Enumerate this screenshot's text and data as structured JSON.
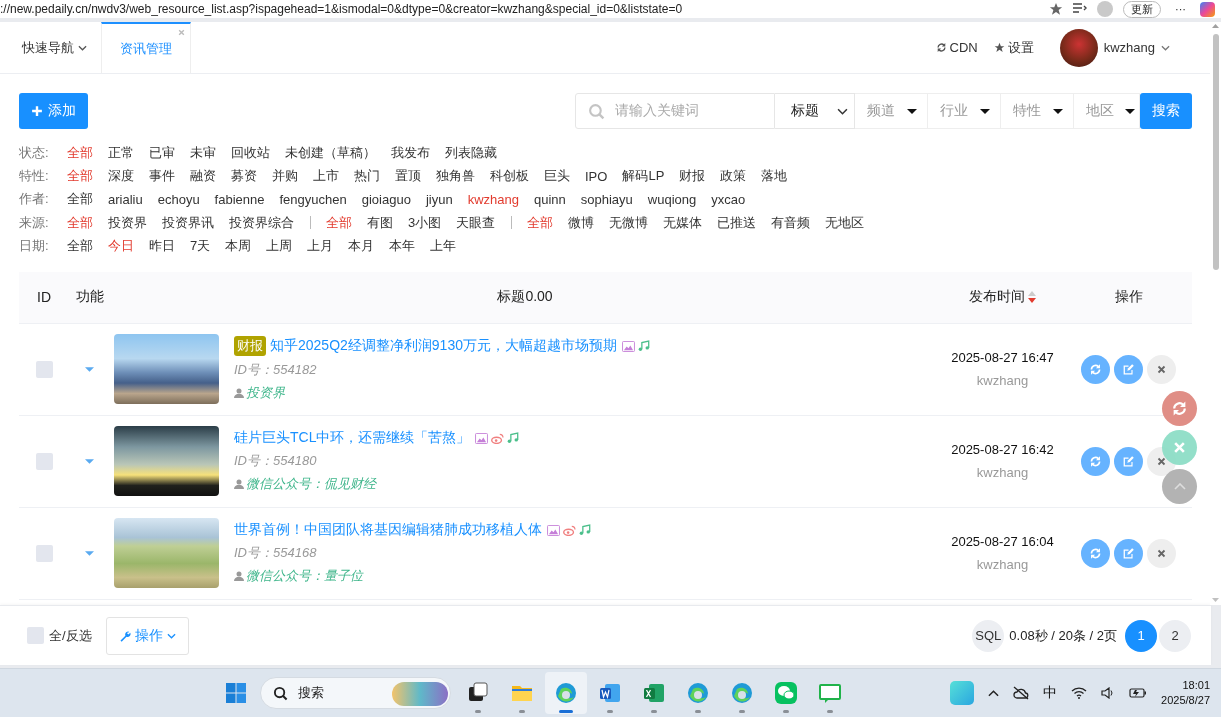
{
  "browser": {
    "url": "://new.pedaily.cn/nwdv3/web_resource_list.asp?ispagehead=1&ismodal=0&dtype=0&creator=kwzhang&special_id=0&liststate=0",
    "update_button": "更新",
    "more_button": "···"
  },
  "header": {
    "nav": "快速导航",
    "tabs": [
      {
        "label": "资讯管理",
        "selected": true
      }
    ],
    "links": [
      {
        "kind": "cdn",
        "label": "CDN"
      },
      {
        "kind": "settings",
        "label": "设置"
      }
    ],
    "user": "kwzhang"
  },
  "toolbar": {
    "add_button": "添加",
    "search": {
      "placeholder": "请输入关键词"
    },
    "field_select": "标题",
    "dropdowns": [
      "频道",
      "行业",
      "特性",
      "地区"
    ],
    "search_button": "搜索"
  },
  "filters": [
    {
      "label": "状态:",
      "groups": [
        [
          {
            "text": "全部",
            "selected": true
          },
          {
            "text": "正常",
            "selected": false
          },
          {
            "text": "已审",
            "selected": false
          },
          {
            "text": "未审",
            "selected": false
          },
          {
            "text": "回收站",
            "selected": false
          },
          {
            "text": "未创建（草稿）",
            "selected": false
          },
          {
            "text": "我发布",
            "selected": false
          },
          {
            "text": "列表隐藏",
            "selected": false
          }
        ]
      ]
    },
    {
      "label": "特性:",
      "groups": [
        [
          {
            "text": "全部",
            "selected": true
          },
          {
            "text": "深度",
            "selected": false
          },
          {
            "text": "事件",
            "selected": false
          },
          {
            "text": "融资",
            "selected": false
          },
          {
            "text": "募资",
            "selected": false
          },
          {
            "text": "并购",
            "selected": false
          },
          {
            "text": "上市",
            "selected": false
          },
          {
            "text": "热门",
            "selected": false
          },
          {
            "text": "置顶",
            "selected": false
          },
          {
            "text": "独角兽",
            "selected": false
          },
          {
            "text": "科创板",
            "selected": false
          },
          {
            "text": "巨头",
            "selected": false
          },
          {
            "text": "IPO",
            "selected": false
          },
          {
            "text": "解码LP",
            "selected": false
          },
          {
            "text": "财报",
            "selected": false
          },
          {
            "text": "政策",
            "selected": false
          },
          {
            "text": "落地",
            "selected": false
          }
        ]
      ]
    },
    {
      "label": "作者:",
      "groups": [
        [
          {
            "text": "全部",
            "selected": false
          },
          {
            "text": "arialiu",
            "selected": false
          },
          {
            "text": "echoyu",
            "selected": false
          },
          {
            "text": "fabienne",
            "selected": false
          },
          {
            "text": "fengyuchen",
            "selected": false
          },
          {
            "text": "gioiaguo",
            "selected": false
          },
          {
            "text": "jiyun",
            "selected": false
          },
          {
            "text": "kwzhang",
            "selected": true
          },
          {
            "text": "quinn",
            "selected": false
          },
          {
            "text": "sophiayu",
            "selected": false
          },
          {
            "text": "wuqiong",
            "selected": false
          },
          {
            "text": "yxcao",
            "selected": false
          }
        ]
      ]
    },
    {
      "label": "来源:",
      "groups": [
        [
          {
            "text": "全部",
            "selected": true
          },
          {
            "text": "投资界",
            "selected": false
          },
          {
            "text": "投资界讯",
            "selected": false
          },
          {
            "text": "投资界综合",
            "selected": false
          }
        ],
        [
          {
            "text": "全部",
            "selected": true
          },
          {
            "text": "有图",
            "selected": false
          },
          {
            "text": "3小图",
            "selected": false
          },
          {
            "text": "天眼查",
            "selected": false
          }
        ],
        [
          {
            "text": "全部",
            "selected": true
          },
          {
            "text": "微博",
            "selected": false
          },
          {
            "text": "无微博",
            "selected": false
          },
          {
            "text": "无媒体",
            "selected": false
          },
          {
            "text": "已推送",
            "selected": false
          },
          {
            "text": "有音频",
            "selected": false
          },
          {
            "text": "无地区",
            "selected": false
          }
        ]
      ]
    },
    {
      "label": "日期:",
      "groups": [
        [
          {
            "text": "全部",
            "selected": false
          },
          {
            "text": "今日",
            "selected": true
          },
          {
            "text": "昨日",
            "selected": false
          },
          {
            "text": "7天",
            "selected": false
          },
          {
            "text": "本周",
            "selected": false
          },
          {
            "text": "上周",
            "selected": false
          },
          {
            "text": "上月",
            "selected": false
          },
          {
            "text": "本月",
            "selected": false
          },
          {
            "text": "本年",
            "selected": false
          },
          {
            "text": "上年",
            "selected": false
          }
        ]
      ]
    }
  ],
  "table": {
    "columns": [
      {
        "label": "ID",
        "sorted": false
      },
      {
        "label": "功能",
        "sorted": false
      },
      {
        "label": "标题0.00",
        "sorted": false
      },
      {
        "label": "发布时间",
        "sorted": true
      },
      {
        "label": "操作",
        "sorted": false
      }
    ],
    "rows": [
      {
        "checked": false,
        "tag": "财报",
        "title": "知乎2025Q2经调整净利润9130万元，大幅超越市场预期",
        "flags": {
          "image": true,
          "weibo": false,
          "music": true
        },
        "id": "ID号：554182",
        "source": "投资界",
        "time": "2025-08-27 16:47",
        "author": "kwzhang"
      },
      {
        "checked": false,
        "title": "硅片巨头TCL中环，还需继续「苦熬」",
        "flags": {
          "image": true,
          "weibo": true,
          "music": true
        },
        "id": "ID号：554180",
        "source": "微信公众号：侃见财经",
        "time": "2025-08-27 16:42",
        "author": "kwzhang"
      },
      {
        "checked": false,
        "title": "世界首例！中国团队将基因编辑猪肺成功移植人体",
        "flags": {
          "image": true,
          "weibo": true,
          "music": true
        },
        "id": "ID号：554168",
        "source": "微信公众号：量子位",
        "time": "2025-08-27 16:04",
        "author": "kwzhang"
      }
    ]
  },
  "footer": {
    "select_all": {
      "label": "全/反选",
      "checked": false
    },
    "action_button": "操作",
    "sql_badge": "SQL",
    "stats": "0.08秒 / 20条 / 2页",
    "pages": [
      {
        "label": "1",
        "selected": true
      },
      {
        "label": "2",
        "selected": false
      }
    ]
  },
  "taskbar": {
    "search": "搜索",
    "apps": [
      {
        "kind": "taskview",
        "active": false
      },
      {
        "kind": "folder",
        "active": false
      },
      {
        "kind": "edge",
        "active": true
      },
      {
        "kind": "word",
        "active": false
      },
      {
        "kind": "excel",
        "active": false
      },
      {
        "kind": "edge",
        "active": false
      },
      {
        "kind": "edge",
        "active": false
      },
      {
        "kind": "wechat",
        "active": false
      },
      {
        "kind": "chat",
        "active": false
      }
    ],
    "ime": "中",
    "time": "18:01",
    "date": "2025/8/27"
  }
}
